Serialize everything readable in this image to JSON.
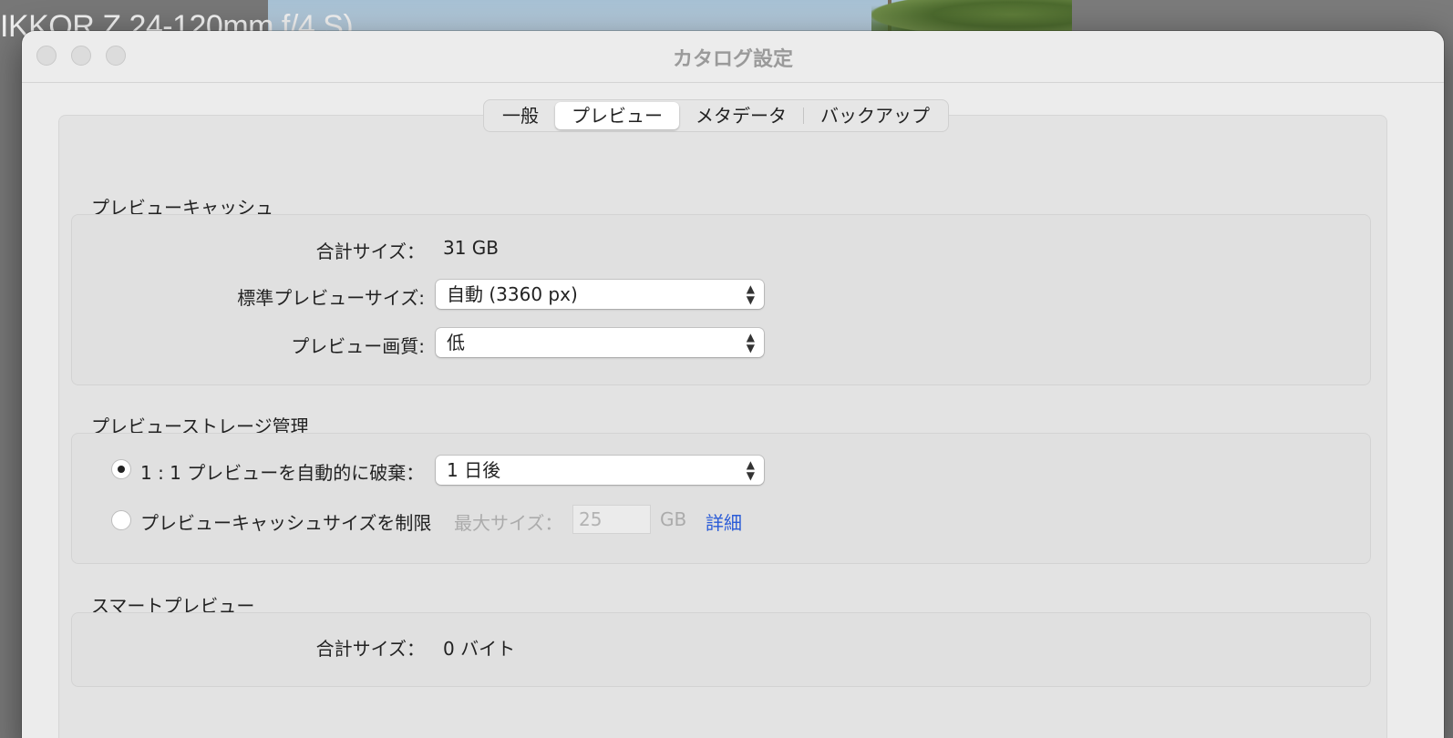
{
  "background": {
    "lens_text": "IKKOR Z 24-120mm f/4 S)",
    "lens_text_top": "…"
  },
  "window": {
    "title": "カタログ設定"
  },
  "tabs": [
    {
      "label": "一般",
      "active": false
    },
    {
      "label": "プレビュー",
      "active": true
    },
    {
      "label": "メタデータ",
      "active": false
    },
    {
      "label": "バックアップ",
      "active": false
    }
  ],
  "preview_cache": {
    "title": "プレビューキャッシュ",
    "total_size_label": "合計サイズ：",
    "total_size_value": "31 GB",
    "standard_size_label": "標準プレビューサイズ:",
    "standard_size_value": "自動 (3360 px)",
    "quality_label": "プレビュー画質:",
    "quality_value": "低"
  },
  "storage": {
    "title": "プレビューストレージ管理",
    "discard_label": "1 : 1 プレビューを自動的に破棄：",
    "discard_selected": true,
    "discard_value": "1 日後",
    "limit_label": "プレビューキャッシュサイズを制限",
    "limit_selected": false,
    "max_size_label": "最大サイズ：",
    "max_size_value": "25",
    "max_size_unit": "GB",
    "details_link": "詳細"
  },
  "smart_preview": {
    "title": "スマートプレビュー",
    "total_size_label": "合計サイズ：",
    "total_size_value": "0 バイト"
  },
  "colors": {
    "window_bg": "#ececec",
    "link": "#2a5bd7"
  }
}
